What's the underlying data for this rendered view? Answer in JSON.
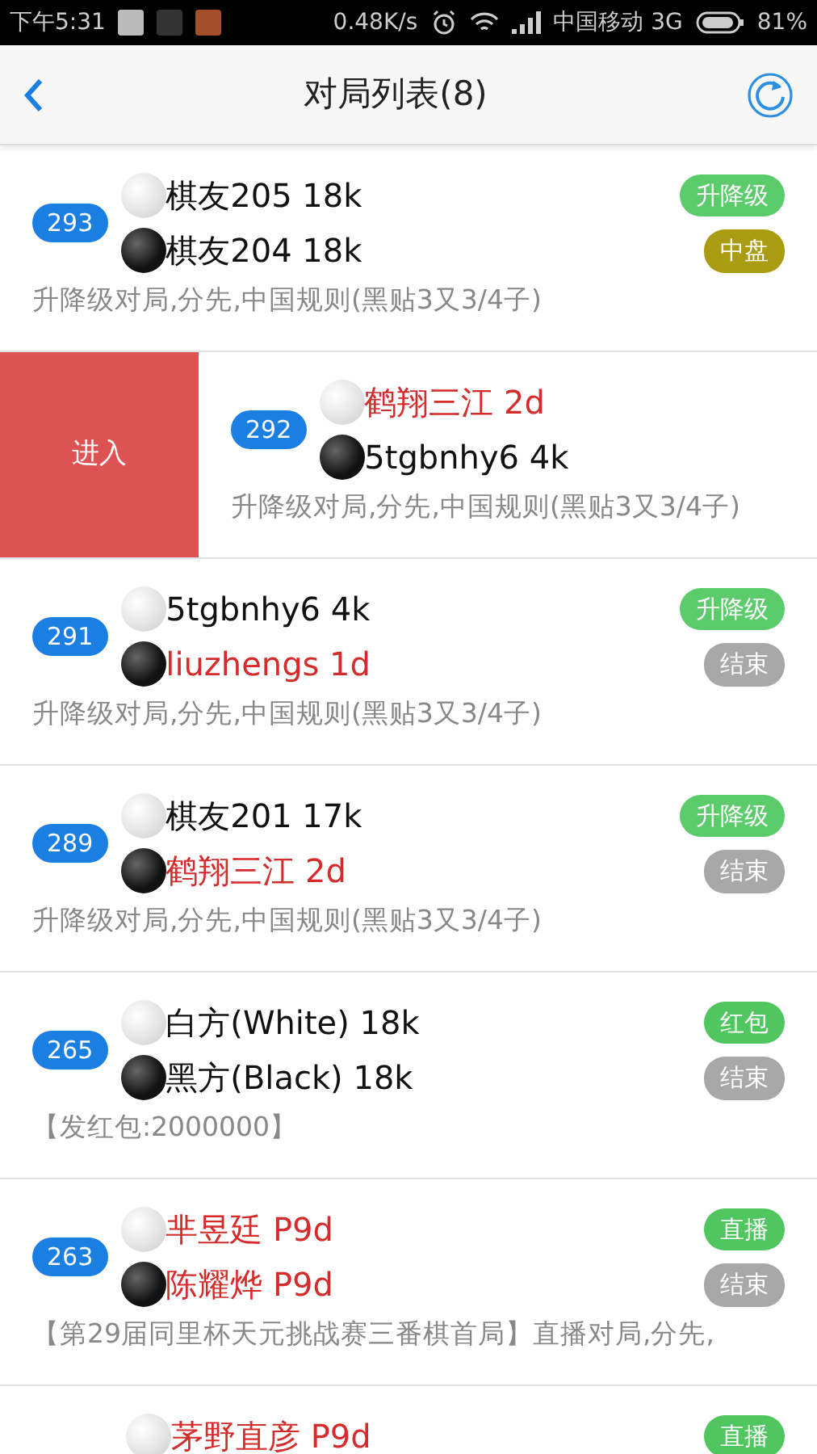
{
  "status_bar": {
    "time": "下午5:31",
    "speed": "0.48K/s",
    "carrier": "中国移动 3G",
    "battery": "81%"
  },
  "header": {
    "title": "对局列表(8)"
  },
  "games": [
    {
      "number": "293",
      "swiped": false,
      "players": [
        {
          "kind": "white",
          "name": "棋友205 18k",
          "emphasized": false
        },
        {
          "kind": "black",
          "name": "棋友204 18k",
          "emphasized": false
        }
      ],
      "tags": [
        {
          "label": "升降级",
          "color": "#5ccb6c"
        },
        {
          "label": "中盘",
          "color": "#a99b12"
        }
      ],
      "description": "升降级对局,分先,中国规则(黑贴3又3/4子)"
    },
    {
      "number": "292",
      "swiped": true,
      "action": "进入",
      "players": [
        {
          "kind": "white",
          "name": "鹤翔三江 2d",
          "emphasized": true
        },
        {
          "kind": "black",
          "name": "5tgbnhy6 4k",
          "emphasized": false
        }
      ],
      "description": "升降级对局,分先,中国规则(黑贴3又3/4子)"
    },
    {
      "number": "291",
      "swiped": false,
      "players": [
        {
          "kind": "white",
          "name": "5tgbnhy6 4k",
          "emphasized": false
        },
        {
          "kind": "black",
          "name": "liuzhengs 1d",
          "emphasized": true
        }
      ],
      "tags": [
        {
          "label": "升降级",
          "color": "#5ccb6c"
        },
        {
          "label": "结束",
          "color": "#a8a8a8"
        }
      ],
      "description": "升降级对局,分先,中国规则(黑贴3又3/4子)"
    },
    {
      "number": "289",
      "swiped": false,
      "players": [
        {
          "kind": "white",
          "name": "棋友201 17k",
          "emphasized": false
        },
        {
          "kind": "black",
          "name": "鹤翔三江 2d",
          "emphasized": true
        }
      ],
      "tags": [
        {
          "label": "升降级",
          "color": "#5ccb6c"
        },
        {
          "label": "结束",
          "color": "#a8a8a8"
        }
      ],
      "description": "升降级对局,分先,中国规则(黑贴3又3/4子)"
    },
    {
      "number": "265",
      "swiped": false,
      "players": [
        {
          "kind": "white",
          "name": "白方(White) 18k",
          "emphasized": false
        },
        {
          "kind": "black",
          "name": "黑方(Black) 18k",
          "emphasized": false
        }
      ],
      "tags": [
        {
          "label": "红包",
          "color": "#4fc65f"
        },
        {
          "label": "结束",
          "color": "#a8a8a8"
        }
      ],
      "description": "【发红包:2000000】"
    },
    {
      "number": "263",
      "swiped": false,
      "players": [
        {
          "kind": "white",
          "name": "芈昱廷 P9d",
          "emphasized": true
        },
        {
          "kind": "black",
          "name": "陈耀烨 P9d",
          "emphasized": true
        }
      ],
      "tags": [
        {
          "label": "直播",
          "color": "#4fc65f"
        },
        {
          "label": "结束",
          "color": "#a8a8a8"
        }
      ],
      "description": "【第29届同里杯天元挑战赛三番棋首局】直播对局,分先,"
    },
    {
      "swiped": false,
      "players": [
        {
          "kind": "white",
          "name": "茅野直彦 P9d",
          "emphasized": true
        }
      ],
      "tags": [
        {
          "label": "直播",
          "color": "#4fc65f"
        }
      ]
    }
  ]
}
